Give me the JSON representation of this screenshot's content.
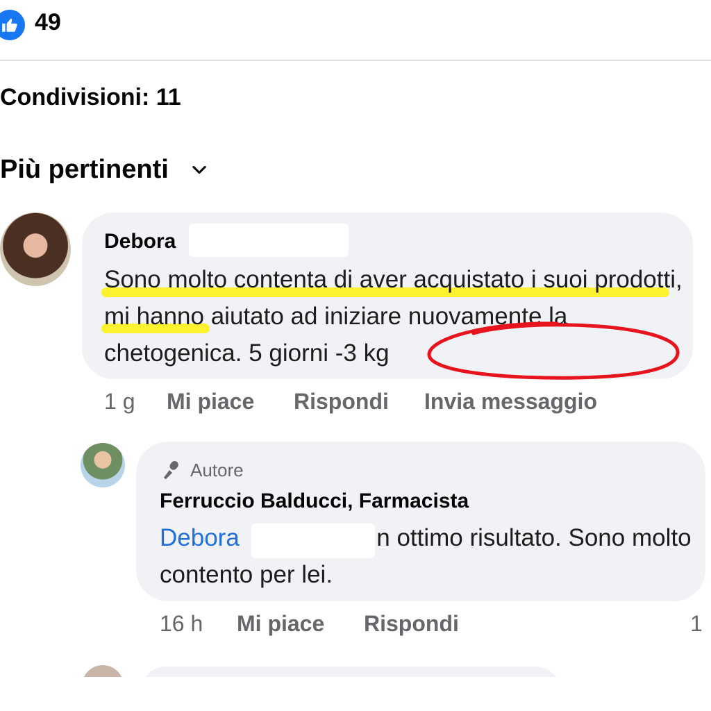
{
  "reactions": {
    "like_count": "49",
    "icon": "thumbs-up-icon"
  },
  "shares": {
    "label": "Condivisioni: 11"
  },
  "sort": {
    "label": "Più pertinenti",
    "icon": "chevron-down-icon"
  },
  "comment": {
    "author": "Debora",
    "text": "Sono molto contenta di aver acquistato i suoi prodotti, mi hanno aiutato ad iniziare nuovamente la chetogenica. 5 giorni -3 kg",
    "time": "1 g",
    "like_label": "Mi piace",
    "reply_label": "Rispondi",
    "message_label": "Invia messaggio"
  },
  "reply": {
    "badge_label": "Autore",
    "badge_icon": "microphone-icon",
    "author": "Ferruccio Balducci, Farmacista",
    "mention": "Debora",
    "text": "un ottimo risultato. Sono molto contento per lei.",
    "time": "16 h",
    "like_label": "Mi piace",
    "reply_label": "Rispondi",
    "reaction_count": "1"
  },
  "colors": {
    "facebook_blue": "#1877f2",
    "mention_blue": "#216fdb",
    "bubble_bg": "#f0f2f5",
    "meta_gray": "#65676b",
    "highlight_yellow": "#fdf22f",
    "annotation_red": "#e8141d"
  }
}
